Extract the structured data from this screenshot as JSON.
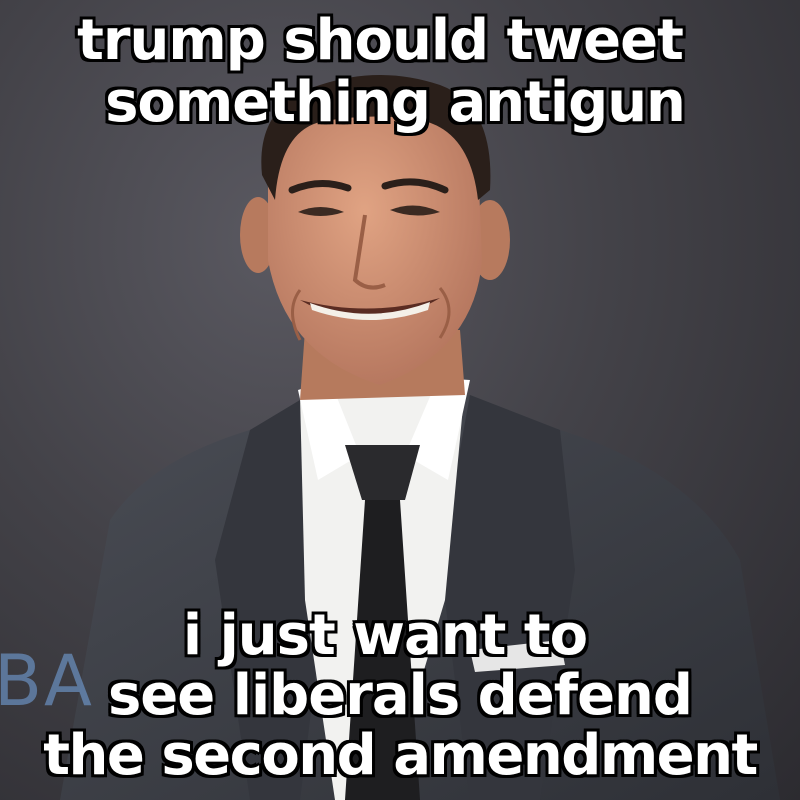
{
  "meme": {
    "top_text": {
      "line_1": "trump should tweet",
      "line_2": "something antigun"
    },
    "bottom_text": {
      "line_1": "i just want to",
      "line_2": "see liberals defend",
      "line_3": "the second amendment"
    },
    "background_sign": "BA",
    "colors": {
      "caption_fill": "#ffffff",
      "caption_outline": "#000000",
      "backdrop": "#434248",
      "suit": "#3a3d44",
      "shirt": "#f2f2f0",
      "tie": "#1e1e20",
      "skin": "#c98b6a",
      "hair": "#2a1f1a",
      "sign_glow": "#78aae6"
    }
  }
}
